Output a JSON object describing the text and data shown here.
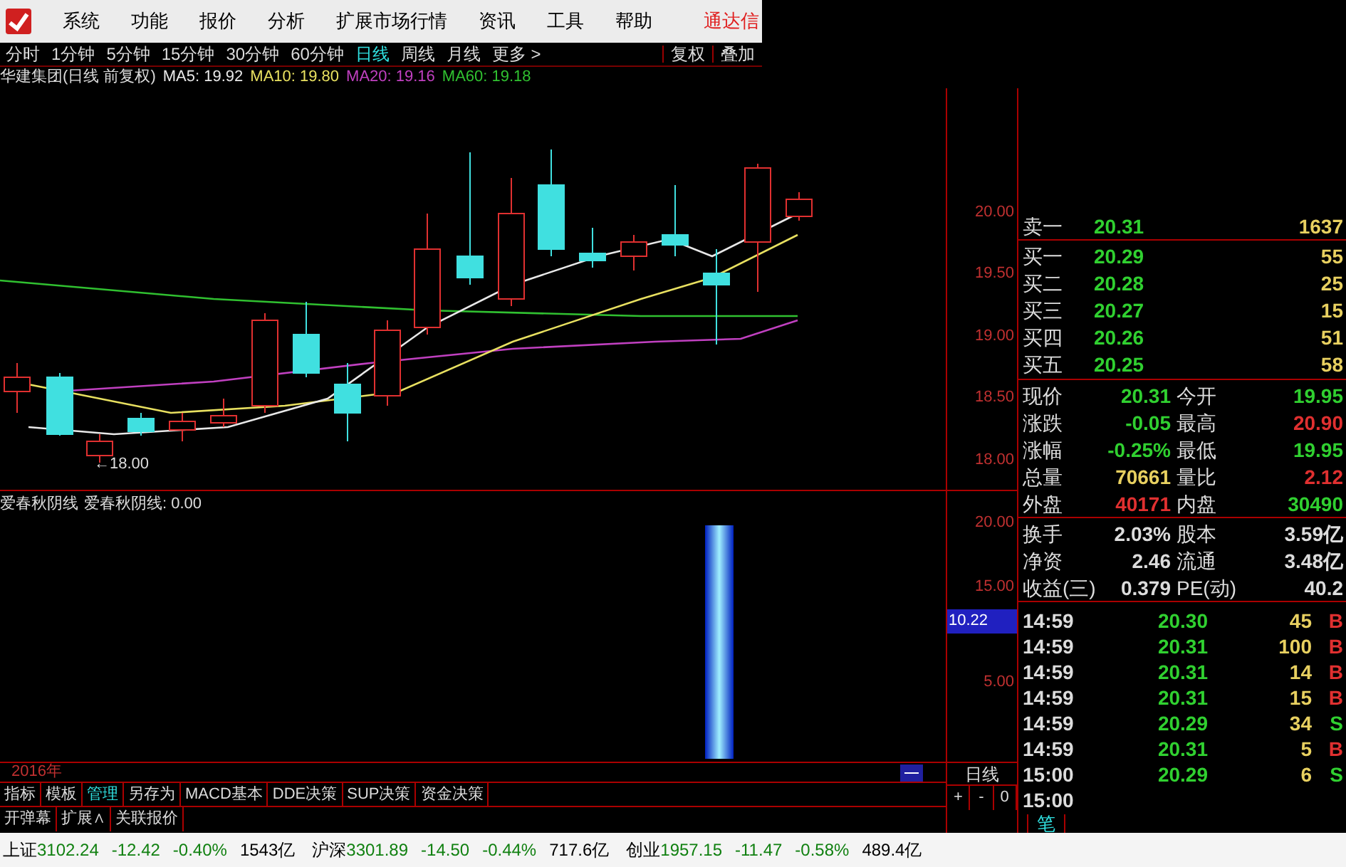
{
  "menu": {
    "items": [
      "系统",
      "功能",
      "报价",
      "分析",
      "扩展市场行情",
      "资讯",
      "工具",
      "帮助"
    ],
    "brand": "通达信"
  },
  "periods": [
    {
      "label": "分时",
      "selected": false
    },
    {
      "label": "1分钟",
      "selected": false
    },
    {
      "label": "5分钟",
      "selected": false
    },
    {
      "label": "15分钟",
      "selected": false
    },
    {
      "label": "30分钟",
      "selected": false
    },
    {
      "label": "60分钟",
      "selected": false
    },
    {
      "label": "日线",
      "selected": true
    },
    {
      "label": "周线",
      "selected": false
    },
    {
      "label": "月线",
      "selected": false
    },
    {
      "label": "更多 >",
      "selected": false
    }
  ],
  "toolbar_buttons": [
    "复权",
    "叠加"
  ],
  "chart_title": {
    "name": "华建集团(日线 前复权)",
    "indicators": [
      {
        "label": "MA5: 19.92",
        "color": "#e8e8e8"
      },
      {
        "label": "MA10: 19.80",
        "color": "#e8e060"
      },
      {
        "label": "MA20: 19.16",
        "color": "#c040c0"
      },
      {
        "label": "MA60: 19.18",
        "color": "#30c030"
      }
    ]
  },
  "price_axis": [
    "20.00",
    "19.50",
    "19.00",
    "18.50",
    "18.00"
  ],
  "low_marker": "←18.00",
  "indicator": {
    "title": "爱春秋阴线",
    "reading": "爱春秋阴线: 0.00",
    "axis": [
      "20.00",
      "15.00",
      "5.00"
    ],
    "tag": "10.22"
  },
  "year_label": "2016年",
  "bottom_tabs": [
    {
      "label": "指标",
      "selected": false
    },
    {
      "label": "模板",
      "selected": false
    },
    {
      "label": "管理",
      "selected": true
    },
    {
      "label": "另存为",
      "selected": false
    },
    {
      "label": "MACD基本",
      "selected": false
    },
    {
      "label": "DDE决策",
      "selected": false
    },
    {
      "label": "SUP决策",
      "selected": false
    },
    {
      "label": "资金决策",
      "selected": false
    }
  ],
  "bottom_links": [
    "开弹幕",
    "扩展∧",
    "关联报价"
  ],
  "period_label": "日线",
  "zoom_buttons": [
    "+",
    "-",
    "0"
  ],
  "order_book": {
    "sell": [
      {
        "label": "卖一",
        "price": "20.31",
        "volume": "1637"
      }
    ],
    "buy": [
      {
        "label": "买一",
        "price": "20.29",
        "volume": "55"
      },
      {
        "label": "买二",
        "price": "20.28",
        "volume": "25"
      },
      {
        "label": "买三",
        "price": "20.27",
        "volume": "15"
      },
      {
        "label": "买四",
        "price": "20.26",
        "volume": "51"
      },
      {
        "label": "买五",
        "price": "20.25",
        "volume": "58"
      }
    ]
  },
  "stats": [
    [
      {
        "label": "现价",
        "value": "20.31",
        "color": "#30d030"
      },
      {
        "label": "今开",
        "value": "19.95",
        "color": "#30d030"
      }
    ],
    [
      {
        "label": "涨跌",
        "value": "-0.05",
        "color": "#30d030"
      },
      {
        "label": "最高",
        "value": "20.90",
        "color": "#e03030"
      }
    ],
    [
      {
        "label": "涨幅",
        "value": "-0.25%",
        "color": "#30d030"
      },
      {
        "label": "最低",
        "value": "19.95",
        "color": "#30d030"
      }
    ],
    [
      {
        "label": "总量",
        "value": "70661",
        "color": "#e8d060"
      },
      {
        "label": "量比",
        "value": "2.12",
        "color": "#e03030"
      }
    ],
    [
      {
        "label": "外盘",
        "value": "40171",
        "color": "#e03030"
      },
      {
        "label": "内盘",
        "value": "30490",
        "color": "#30d030"
      }
    ]
  ],
  "stats2": [
    {
      "label": "换手",
      "value": "2.03%",
      "label2": "股本",
      "value2": "3.59亿"
    },
    {
      "label": "净资",
      "value": "2.46",
      "label2": "流通",
      "value2": "3.48亿"
    },
    {
      "label": "收益(三)",
      "value": "0.379",
      "label2": "PE(动)",
      "value2": "40.2"
    }
  ],
  "trades": [
    {
      "time": "14:59",
      "price": "20.30",
      "volume": "45",
      "side": "B"
    },
    {
      "time": "14:59",
      "price": "20.31",
      "volume": "100",
      "side": "B"
    },
    {
      "time": "14:59",
      "price": "20.31",
      "volume": "14",
      "side": "B"
    },
    {
      "time": "14:59",
      "price": "20.31",
      "volume": "15",
      "side": "B"
    },
    {
      "time": "14:59",
      "price": "20.29",
      "volume": "34",
      "side": "S"
    },
    {
      "time": "14:59",
      "price": "20.31",
      "volume": "5",
      "side": "B"
    },
    {
      "time": "15:00",
      "price": "20.29",
      "volume": "6",
      "side": "S"
    },
    {
      "time": "15:00"
    }
  ],
  "detail_tab": "笔",
  "status_bar": [
    {
      "name": "上证",
      "price": "3102.24",
      "change": "-12.42",
      "pct": "-0.40%",
      "amount": "1543亿"
    },
    {
      "name": "沪深",
      "price": "3301.89",
      "change": "-14.50",
      "pct": "-0.44%",
      "amount": "717.6亿"
    },
    {
      "name": "创业",
      "price": "1957.15",
      "change": "-11.47",
      "pct": "-0.58%",
      "amount": "489.4亿"
    }
  ]
}
